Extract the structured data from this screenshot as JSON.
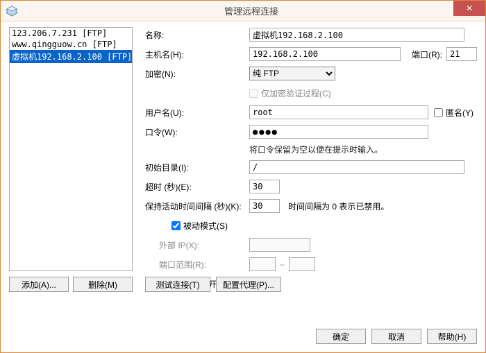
{
  "window": {
    "title": "管理远程连接",
    "close_glyph": "✕"
  },
  "connections": {
    "items": [
      {
        "label": "123.206.7.231 [FTP]",
        "selected": false
      },
      {
        "label": "www.qingguow.cn [FTP]",
        "selected": false
      },
      {
        "label": "虚拟机192.168.2.100 [FTP]",
        "selected": true
      }
    ]
  },
  "buttons": {
    "add": "添加(A)...",
    "delete": "删除(M)",
    "test": "测试连接(T)",
    "proxy": "配置代理(P)...",
    "ok": "确定",
    "cancel": "取消",
    "help": "帮助(H)"
  },
  "labels": {
    "name": "名称:",
    "host": "主机名(H):",
    "port": "端口(R):",
    "encryption": "加密(N):",
    "only_encrypt_auth": "仅加密验证过程(C)",
    "username": "用户名(U):",
    "anonymous": "匿名(Y)",
    "password": "口令(W):",
    "password_hint": "将口令保留为空以便在提示时输入。",
    "initial_dir": "初始目录(I):",
    "timeout": "超时 (秒)(E):",
    "keepalive": "保持活动时间间隔 (秒)(K):",
    "keepalive_hint": "时间间隔为 0 表示已禁用。",
    "passive": "被动模式(S)",
    "ext_ip": "外部 IP(X):",
    "port_range": "端口范围(R):",
    "ignore_disconnect": "忽略断开连接错误(G)"
  },
  "values": {
    "name": "虚拟机192.168.2.100",
    "host": "192.168.2.100",
    "port": "21",
    "encryption": "纯 FTP",
    "only_encrypt_auth_checked": false,
    "username": "root",
    "anonymous_checked": false,
    "password_masked": "●●●●",
    "initial_dir": "/",
    "timeout": "30",
    "keepalive": "30",
    "passive_checked": true,
    "ext_ip": "",
    "port_range_from": "",
    "port_range_to": "",
    "ignore_disconnect_checked": true
  }
}
